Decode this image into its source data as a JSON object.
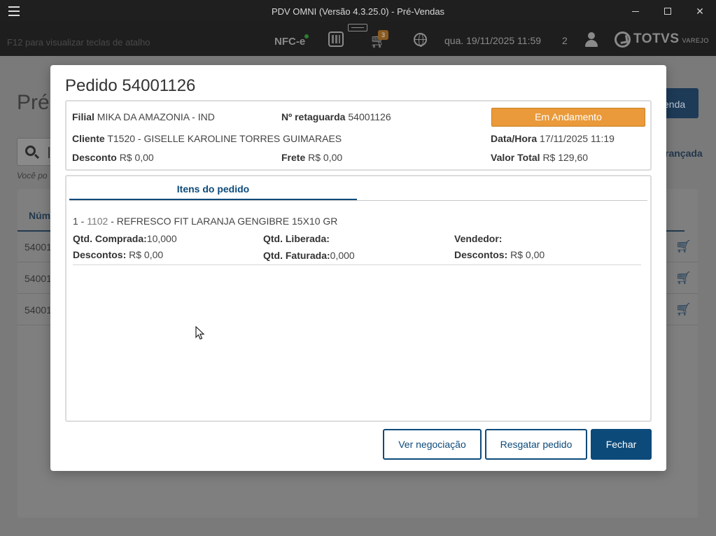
{
  "window": {
    "title": "PDV OMNI (Versão 4.3.25.0) - Pré-Vendas"
  },
  "appbar": {
    "shortcut_hint": "F12 para visualizar teclas de atalho",
    "nfce_label": "NFC-e",
    "cart_badge": "3",
    "datetime": "qua. 19/11/2025 11:59",
    "count": "2",
    "logo_text": "TOTVS",
    "logo_sub": "VAREJO"
  },
  "background": {
    "page_title": "Pré",
    "new_button_partial": "enda",
    "advanced_partial": "rançada",
    "hint_partial": "Você po",
    "column_partial": "Núm",
    "rows": [
      "54001",
      "54001",
      "54001"
    ]
  },
  "modal": {
    "title": "Pedido 54001126",
    "status": "Em Andamento",
    "filial_label": "Filial",
    "filial_value": "MIKA DA AMAZONIA - IND",
    "retaguarda_label": "Nº retaguarda",
    "retaguarda_value": "54001126",
    "cliente_label": "Cliente",
    "cliente_value": "T1520 - GISELLE KAROLINE TORRES GUIMARAES",
    "datahora_label": "Data/Hora",
    "datahora_value": "17/11/2025 11:19",
    "desconto_label": "Desconto",
    "desconto_value": "R$ 0,00",
    "frete_label": "Frete",
    "frete_value": "R$ 0,00",
    "valortotal_label": "Valor Total",
    "valortotal_value": "R$ 129,60",
    "tab_label": "Itens do pedido",
    "item": {
      "index": "1 - ",
      "code": "1102",
      "description": " - REFRESCO FIT LARANJA GENGIBRE 15X10 GR",
      "qtd_comprada_label": "Qtd. Comprada:",
      "qtd_comprada_value": "10,000",
      "qtd_liberada_label": "Qtd. Liberada:",
      "qtd_liberada_value": "",
      "vendedor_label": "Vendedor:",
      "vendedor_value": "",
      "descontos_label": "Descontos:",
      "descontos_value": "R$ 0,00",
      "qtd_faturada_label": "Qtd. Faturada:",
      "qtd_faturada_value": "0,000",
      "descontos2_label": "Descontos:",
      "descontos2_value": "R$ 0,00"
    },
    "buttons": {
      "negociacao": "Ver negociação",
      "resgatar": "Resgatar pedido",
      "fechar": "Fechar"
    }
  },
  "colors": {
    "primary": "#0c4a7a",
    "status": "#ea9a3a"
  }
}
